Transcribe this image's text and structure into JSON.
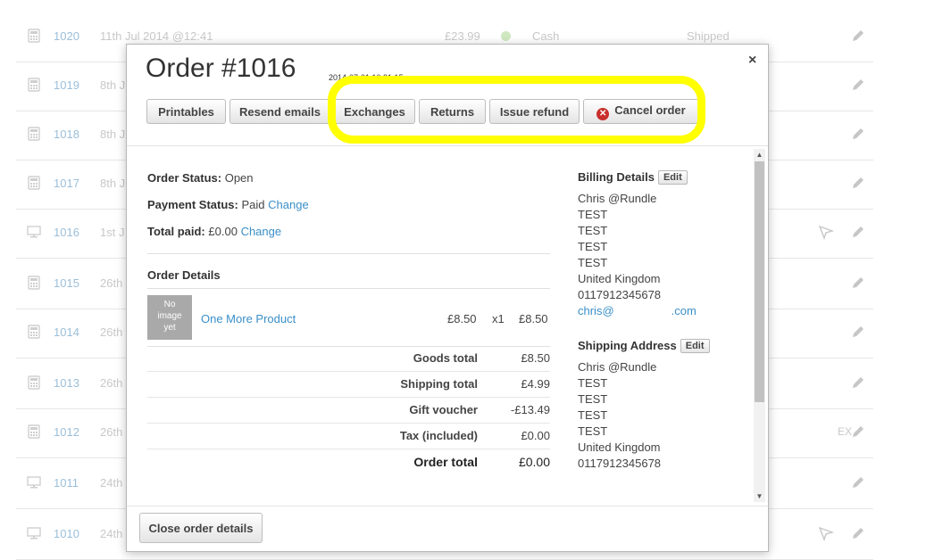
{
  "background_rows": [
    {
      "id": "1020",
      "date": "11th Jul 2014 @12:41",
      "amount": "£23.99",
      "payment": "Cash",
      "status": "Shipped",
      "icon": "calculator-icon",
      "send": false,
      "tag": ""
    },
    {
      "id": "1019",
      "date": "8th J",
      "amount": "",
      "payment": "",
      "status": "",
      "icon": "calculator-icon",
      "send": false,
      "tag": ""
    },
    {
      "id": "1018",
      "date": "8th J",
      "amount": "",
      "payment": "",
      "status": "",
      "icon": "calculator-icon",
      "send": false,
      "tag": ""
    },
    {
      "id": "1017",
      "date": "8th J",
      "amount": "",
      "payment": "",
      "status": "",
      "icon": "calculator-icon",
      "send": false,
      "tag": ""
    },
    {
      "id": "1016",
      "date": "1st J",
      "amount": "",
      "payment": "",
      "status": "",
      "icon": "monitor-icon",
      "send": true,
      "tag": ""
    },
    {
      "id": "1015",
      "date": "26th",
      "amount": "",
      "payment": "",
      "status": "",
      "icon": "calculator-icon",
      "send": false,
      "tag": ""
    },
    {
      "id": "1014",
      "date": "26th",
      "amount": "",
      "payment": "",
      "status": "",
      "icon": "calculator-icon",
      "send": false,
      "tag": ""
    },
    {
      "id": "1013",
      "date": "26th",
      "amount": "",
      "payment": "",
      "status": "",
      "icon": "calculator-icon",
      "send": false,
      "tag": ""
    },
    {
      "id": "1012",
      "date": "26th",
      "amount": "",
      "payment": "",
      "status": "",
      "icon": "calculator-icon",
      "send": false,
      "tag": "EX"
    },
    {
      "id": "1011",
      "date": "24th",
      "amount": "",
      "payment": "",
      "status": "",
      "icon": "monitor-icon",
      "send": false,
      "tag": ""
    },
    {
      "id": "1010",
      "date": "24th",
      "amount": "",
      "payment": "",
      "status": "",
      "icon": "monitor-icon",
      "send": true,
      "tag": ""
    }
  ],
  "modal": {
    "title": "Order #1016",
    "timestamp": "2014-07-01 10:31:15",
    "close_glyph": "×",
    "buttons": {
      "printables": "Printables",
      "resend_emails": "Resend emails",
      "exchanges": "Exchanges",
      "returns": "Returns",
      "issue_refund": "Issue refund",
      "cancel_order": "Cancel order"
    },
    "status": {
      "order_status_label": "Order Status:",
      "order_status_value": "Open",
      "payment_status_label": "Payment Status:",
      "payment_status_value": "Paid",
      "payment_change": "Change",
      "total_paid_label": "Total paid:",
      "total_paid_value": "£0.00",
      "total_paid_change": "Change"
    },
    "order_details": {
      "title": "Order Details",
      "no_image": [
        "No",
        "image",
        "yet"
      ],
      "product": {
        "name": "One More Product",
        "price": "£8.50",
        "qty": "x1",
        "total": "£8.50"
      },
      "totals": [
        {
          "label": "Goods total",
          "value": "£8.50"
        },
        {
          "label": "Shipping total",
          "value": "£4.99"
        },
        {
          "label": "Gift voucher",
          "value": "-£13.49"
        },
        {
          "label": "Tax (included)",
          "value": "£0.00"
        },
        {
          "label": "Order total",
          "value": "£0.00"
        }
      ]
    },
    "billing": {
      "title": "Billing Details",
      "edit": "Edit",
      "lines": [
        "Chris @Rundle",
        "TEST",
        "TEST",
        "TEST",
        "TEST",
        "United Kingdom",
        "0117912345678"
      ],
      "email_start": "chris@",
      "email_end": ".com"
    },
    "shipping": {
      "title": "Shipping Address",
      "edit": "Edit",
      "lines": [
        "Chris @Rundle",
        "TEST",
        "TEST",
        "TEST",
        "TEST",
        "United Kingdom",
        "0117912345678"
      ]
    },
    "footer": {
      "close_details": "Close order details"
    }
  },
  "colors": {
    "highlight": "#ffff00",
    "link": "#3a8fc8",
    "cancel_icon": "#c9302c"
  }
}
